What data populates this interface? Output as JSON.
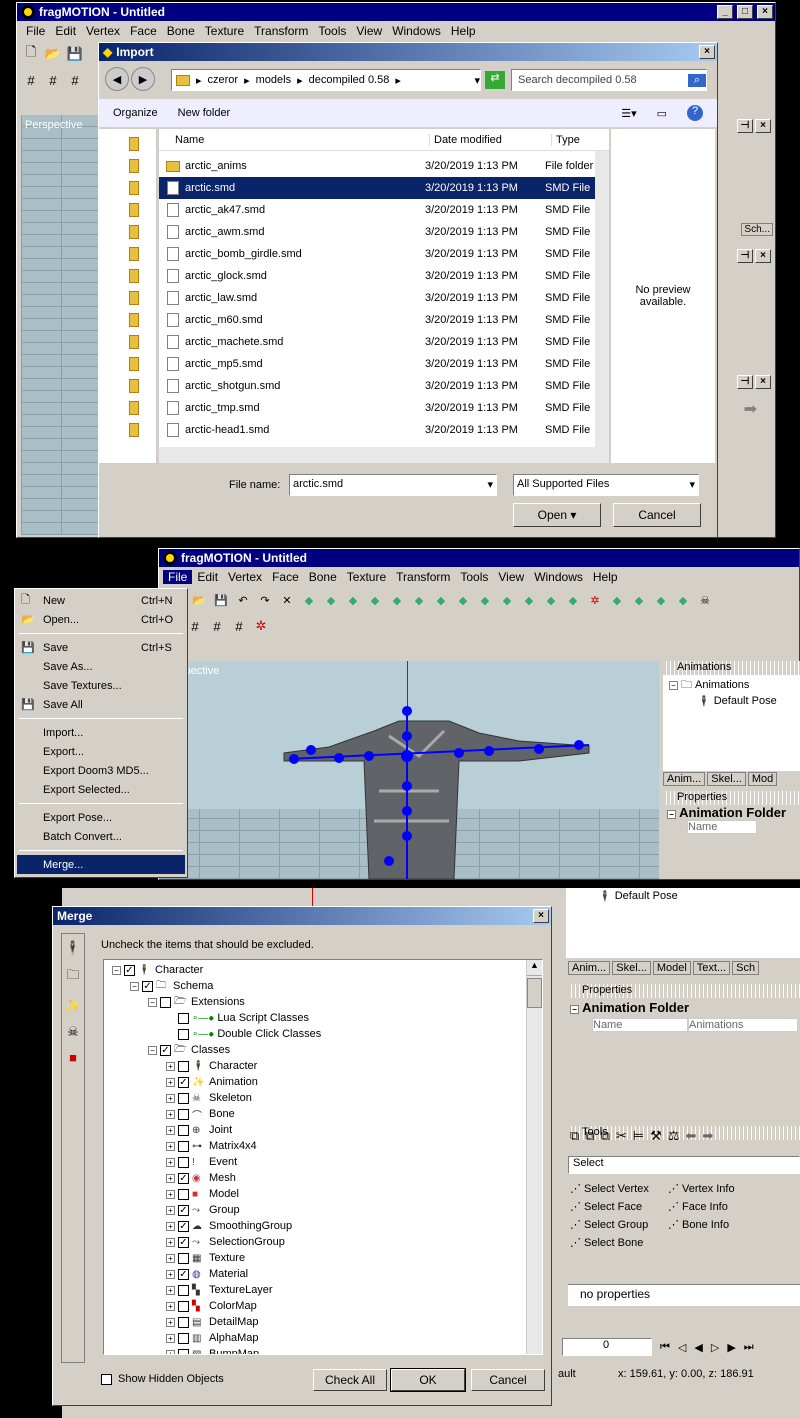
{
  "app_title": "fragMOTION - Untitled",
  "menu": [
    "File",
    "Edit",
    "Vertex",
    "Face",
    "Bone",
    "Texture",
    "Transform",
    "Tools",
    "View",
    "Windows",
    "Help"
  ],
  "viewport_label": "Perspective",
  "viewport_label_partial": "spective",
  "import_dialog": {
    "title": "Import",
    "breadcrumb": [
      "czeror",
      "models",
      "decompiled 0.58"
    ],
    "search_placeholder": "Search decompiled 0.58",
    "organize": "Organize",
    "new_folder": "New folder",
    "columns": [
      "Name",
      "Date modified",
      "Type"
    ],
    "files": [
      {
        "name": "arctic_anims",
        "date": "3/20/2019 1:13 PM",
        "type": "File folder",
        "folder": true
      },
      {
        "name": "arctic.smd",
        "date": "3/20/2019 1:13 PM",
        "type": "SMD File",
        "selected": true
      },
      {
        "name": "arctic_ak47.smd",
        "date": "3/20/2019 1:13 PM",
        "type": "SMD File"
      },
      {
        "name": "arctic_awm.smd",
        "date": "3/20/2019 1:13 PM",
        "type": "SMD File"
      },
      {
        "name": "arctic_bomb_girdle.smd",
        "date": "3/20/2019 1:13 PM",
        "type": "SMD File"
      },
      {
        "name": "arctic_glock.smd",
        "date": "3/20/2019 1:13 PM",
        "type": "SMD File"
      },
      {
        "name": "arctic_law.smd",
        "date": "3/20/2019 1:13 PM",
        "type": "SMD File"
      },
      {
        "name": "arctic_m60.smd",
        "date": "3/20/2019 1:13 PM",
        "type": "SMD File"
      },
      {
        "name": "arctic_machete.smd",
        "date": "3/20/2019 1:13 PM",
        "type": "SMD File"
      },
      {
        "name": "arctic_mp5.smd",
        "date": "3/20/2019 1:13 PM",
        "type": "SMD File"
      },
      {
        "name": "arctic_shotgun.smd",
        "date": "3/20/2019 1:13 PM",
        "type": "SMD File"
      },
      {
        "name": "arctic_tmp.smd",
        "date": "3/20/2019 1:13 PM",
        "type": "SMD File"
      },
      {
        "name": "arctic-head1.smd",
        "date": "3/20/2019 1:13 PM",
        "type": "SMD File"
      }
    ],
    "preview_text": "No preview available.",
    "filename_label": "File name:",
    "filename_value": "arctic.smd",
    "filter_value": "All Supported Files",
    "open_label": "Open",
    "cancel_label": "Cancel"
  },
  "file_menu": [
    {
      "label": "New",
      "shortcut": "Ctrl+N",
      "icon": "new-doc-icon"
    },
    {
      "label": "Open...",
      "shortcut": "Ctrl+O",
      "icon": "open-folder-icon"
    },
    {
      "sep": true
    },
    {
      "label": "Save",
      "shortcut": "Ctrl+S",
      "icon": "save-icon"
    },
    {
      "label": "Save As...",
      "shortcut": ""
    },
    {
      "label": "Save Textures...",
      "shortcut": ""
    },
    {
      "label": "Save All",
      "shortcut": "",
      "icon": "save-all-icon"
    },
    {
      "sep": true
    },
    {
      "label": "Import...",
      "shortcut": ""
    },
    {
      "label": "Export...",
      "shortcut": ""
    },
    {
      "label": "Export Doom3 MD5...",
      "shortcut": ""
    },
    {
      "label": "Export Selected...",
      "shortcut": ""
    },
    {
      "sep": true
    },
    {
      "label": "Export Pose...",
      "shortcut": ""
    },
    {
      "label": "Batch Convert...",
      "shortcut": ""
    },
    {
      "sep": true
    },
    {
      "label": "Merge...",
      "shortcut": "",
      "selected": true
    }
  ],
  "right_panel": {
    "animations_header": "Animations",
    "animations_root": "Animations",
    "default_pose": "Default Pose",
    "tabs_small": [
      "Anim...",
      "Skel...",
      "Mod"
    ],
    "tabs_full": [
      "Anim...",
      "Skel...",
      "Model",
      "Text...",
      "Sch"
    ],
    "properties_header": "Properties",
    "animation_folder": "Animation Folder",
    "prop_name": "Name",
    "prop_value": "Animations",
    "tools_header": "Tools",
    "select_dropdown": "Select",
    "tool_items": [
      "Select Vertex",
      "Vertex Info",
      "Select Face",
      "Face Info",
      "Select Group",
      "Bone Info",
      "Select Bone"
    ],
    "no_properties": "no properties",
    "frame_value": "0",
    "status_coords": "x: 159.61, y: 0.00, z: 186.91",
    "status_partial": "ault",
    "sch_tab": "Sch..."
  },
  "merge_dialog": {
    "title": "Merge",
    "instruction": "Uncheck the items that should be excluded.",
    "tree": [
      {
        "label": "Character",
        "level": 0,
        "checked": true,
        "icon": "character-icon",
        "exp": "-"
      },
      {
        "label": "Schema",
        "level": 1,
        "checked": true,
        "icon": "folder-icon",
        "exp": "-"
      },
      {
        "label": "Extensions",
        "level": 2,
        "checked": false,
        "icon": "folder-open-icon",
        "exp": "-"
      },
      {
        "label": "Lua Script Classes",
        "level": 3,
        "checked": false,
        "icon": "plugin-icon",
        "exp": ""
      },
      {
        "label": "Double Click Classes",
        "level": 3,
        "checked": false,
        "icon": "plugin-icon",
        "exp": ""
      },
      {
        "label": "Classes",
        "level": 2,
        "checked": true,
        "icon": "folder-open-icon",
        "exp": "-"
      },
      {
        "label": "Character",
        "level": 3,
        "checked": false,
        "icon": "character-icon",
        "exp": "+"
      },
      {
        "label": "Animation",
        "level": 3,
        "checked": true,
        "icon": "animation-icon",
        "exp": "+"
      },
      {
        "label": "Skeleton",
        "level": 3,
        "checked": false,
        "icon": "skeleton-icon",
        "exp": "+"
      },
      {
        "label": "Bone",
        "level": 3,
        "checked": false,
        "icon": "bone-icon",
        "exp": "+"
      },
      {
        "label": "Joint",
        "level": 3,
        "checked": false,
        "icon": "joint-icon",
        "exp": "+"
      },
      {
        "label": "Matrix4x4",
        "level": 3,
        "checked": false,
        "icon": "matrix-icon",
        "exp": "+"
      },
      {
        "label": "Event",
        "level": 3,
        "checked": false,
        "icon": "event-icon",
        "exp": "+"
      },
      {
        "label": "Mesh",
        "level": 3,
        "checked": true,
        "icon": "mesh-icon",
        "exp": "+"
      },
      {
        "label": "Model",
        "level": 3,
        "checked": false,
        "icon": "model-icon",
        "exp": "+"
      },
      {
        "label": "Group",
        "level": 3,
        "checked": true,
        "icon": "group-icon",
        "exp": "+"
      },
      {
        "label": "SmoothingGroup",
        "level": 3,
        "checked": true,
        "icon": "smoothing-icon",
        "exp": "+"
      },
      {
        "label": "SelectionGroup",
        "level": 3,
        "checked": true,
        "icon": "selection-icon",
        "exp": "+"
      },
      {
        "label": "Texture",
        "level": 3,
        "checked": false,
        "icon": "texture-icon",
        "exp": "+"
      },
      {
        "label": "Material",
        "level": 3,
        "checked": true,
        "icon": "material-icon",
        "exp": "+"
      },
      {
        "label": "TextureLayer",
        "level": 3,
        "checked": false,
        "icon": "texturelayer-icon",
        "exp": "+"
      },
      {
        "label": "ColorMap",
        "level": 3,
        "checked": false,
        "icon": "colormap-icon",
        "exp": "+"
      },
      {
        "label": "DetailMap",
        "level": 3,
        "checked": false,
        "icon": "detailmap-icon",
        "exp": "+"
      },
      {
        "label": "AlphaMap",
        "level": 3,
        "checked": false,
        "icon": "alphamap-icon",
        "exp": "+"
      },
      {
        "label": "BumpMap",
        "level": 3,
        "checked": false,
        "icon": "bumpmap-icon",
        "exp": "+"
      }
    ],
    "show_hidden": "Show Hidden Objects",
    "check_all": "Check All",
    "ok": "OK",
    "cancel": "Cancel"
  },
  "colors": {
    "title_bar": "#000080",
    "selection": "#0a246a",
    "face": "#d4d0c8",
    "bone_blue": "#0000ff"
  }
}
